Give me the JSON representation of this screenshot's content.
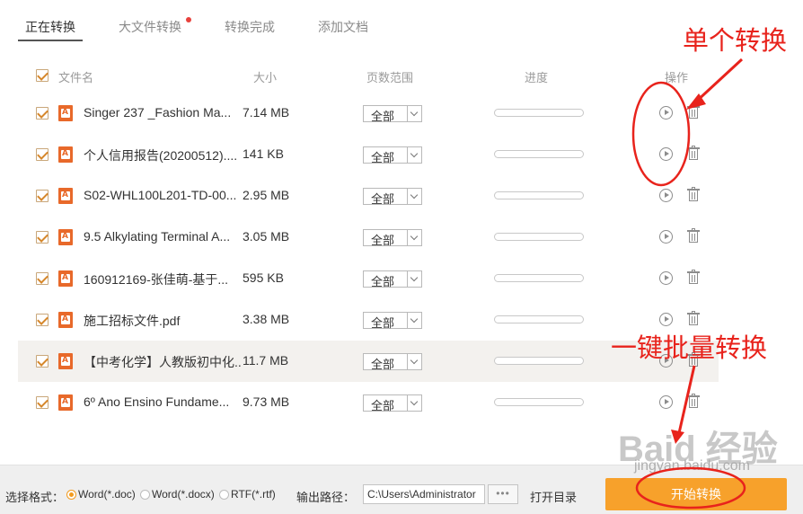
{
  "tabs": [
    {
      "label": "正在转换",
      "active": true
    },
    {
      "label": "大文件转换",
      "badge": true
    },
    {
      "label": "转换完成"
    },
    {
      "label": "添加文档"
    }
  ],
  "columns": {
    "name": "文件名",
    "size": "大小",
    "pages": "页数范围",
    "progress": "进度",
    "actions": "操作"
  },
  "files": [
    {
      "name": "Singer  237 _Fashion Ma...",
      "size": "7.14 MB",
      "range": "全部",
      "progress": 0
    },
    {
      "name": "个人信用报告(20200512)....",
      "size": "141 KB",
      "range": "全部",
      "progress": 0
    },
    {
      "name": "S02-WHL100L201-TD-00...",
      "size": "2.95 MB",
      "range": "全部",
      "progress": 0
    },
    {
      "name": "9.5 Alkylating Terminal A...",
      "size": "3.05 MB",
      "range": "全部",
      "progress": 0
    },
    {
      "name": "160912169-张佳萌-基于...",
      "size": "595 KB",
      "range": "全部",
      "progress": 0
    },
    {
      "name": "施工招标文件.pdf",
      "size": "3.38 MB",
      "range": "全部",
      "progress": 0
    },
    {
      "name": "【中考化学】人教版初中化...",
      "size": "11.7 MB",
      "range": "全部",
      "progress": 0,
      "highlighted": true
    },
    {
      "name": "6º Ano Ensino Fundame...",
      "size": "9.73 MB",
      "range": "全部",
      "progress": 0
    }
  ],
  "bottom": {
    "format_label": "选择格式：",
    "formats": [
      {
        "label": "Word(*.doc)",
        "selected": true
      },
      {
        "label": "Word(*.docx)",
        "selected": false
      },
      {
        "label": "RTF(*.rtf)",
        "selected": false
      }
    ],
    "output_label": "输出路径：",
    "output_path": "C:\\Users\\Administrator",
    "more_label": "•••",
    "open_dir_label": "打开目录",
    "start_label": "开始转换"
  },
  "annotations": {
    "single_label": "单个转换",
    "batch_label": "一键批量转换",
    "color": "#e8231c"
  },
  "watermark": {
    "text": "Baid 经验",
    "sub": "jingyan.baidu.com"
  },
  "icons": {
    "file": "pdf-file-icon",
    "play": "play-circle-icon",
    "delete": "trash-icon"
  },
  "colors": {
    "accent": "#f7a12b",
    "checkbox": "#d6872b",
    "badge": "#e8413c"
  }
}
